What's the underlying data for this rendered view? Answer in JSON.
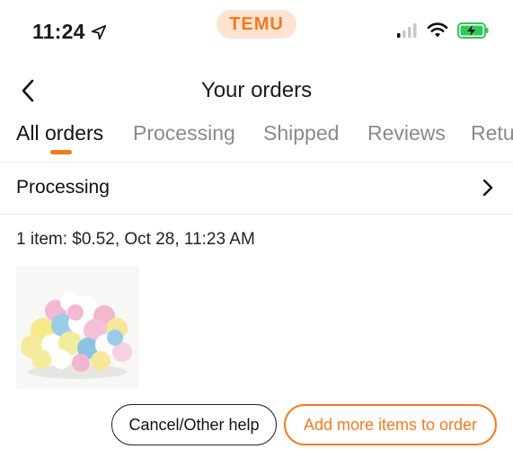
{
  "status_bar": {
    "time": "11:24",
    "brand": "TEMU"
  },
  "header": {
    "title": "Your orders"
  },
  "tabs": [
    {
      "label": "All orders",
      "active": true
    },
    {
      "label": "Processing",
      "active": false
    },
    {
      "label": "Shipped",
      "active": false
    },
    {
      "label": "Reviews",
      "active": false
    },
    {
      "label": "Retu",
      "active": false
    }
  ],
  "order": {
    "status_label": "Processing",
    "summary": "1 item: $0.52, Oct 28, 11:23 AM"
  },
  "actions": {
    "cancel_label": "Cancel/Other help",
    "add_label": "Add more items to order"
  },
  "colors": {
    "accent": "#f47a20",
    "battery": "#34c759"
  },
  "icons": {
    "location": "location-arrow-icon",
    "signal": "cellular-signal-icon",
    "wifi": "wifi-icon",
    "battery": "battery-charging-icon",
    "back": "chevron-left-icon",
    "row_chevron": "chevron-right-icon"
  }
}
